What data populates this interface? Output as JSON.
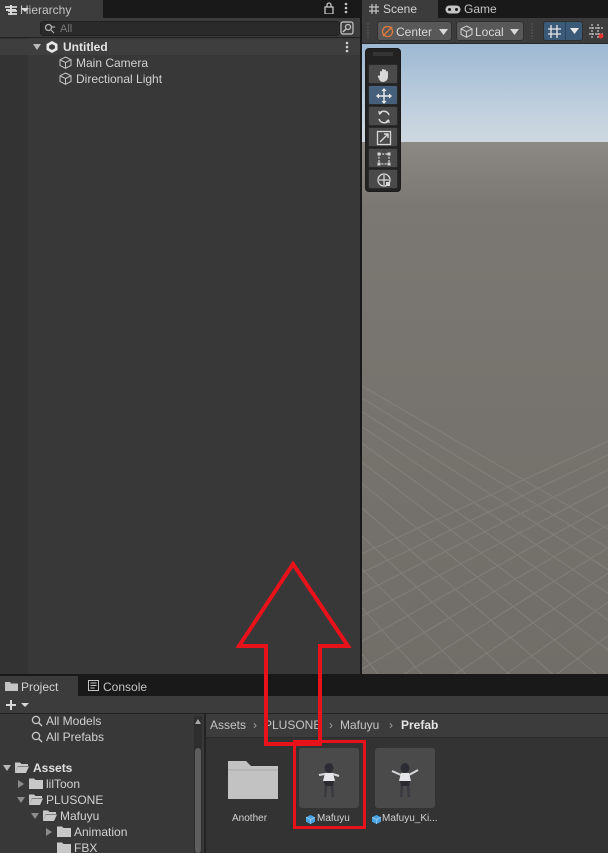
{
  "hierarchy": {
    "tab_label": "Hierarchy",
    "search_placeholder": "All",
    "scene_name": "Untitled",
    "objects": [
      "Main Camera",
      "Directional Light"
    ]
  },
  "scene_view": {
    "tabs": [
      "Scene",
      "Game"
    ],
    "pivot_label": "Center",
    "space_label": "Local",
    "tools": [
      "hand",
      "move",
      "rotate",
      "scale",
      "rect",
      "transform"
    ],
    "active_tool": "move",
    "colors": {
      "sky_top": "#9db9d3",
      "horizon": "#cfd8df",
      "ground": "#74706b"
    }
  },
  "project": {
    "tabs": [
      "Project",
      "Console"
    ],
    "tree": {
      "favorites": [
        "All Models",
        "All Prefabs"
      ],
      "root": "Assets",
      "folders": [
        "lilToon",
        "PLUSONE",
        "Mafuyu",
        "Animation",
        "FBX"
      ]
    },
    "breadcrumb": [
      "Assets",
      "PLUSONE",
      "Mafuyu",
      "Prefab"
    ],
    "items": [
      {
        "name": "Another",
        "kind": "folder"
      },
      {
        "name": "Mafuyu",
        "kind": "prefab"
      },
      {
        "name": "Mafuyu_Ki...",
        "kind": "prefab"
      }
    ]
  },
  "annotation": {
    "color": "#e8121a"
  }
}
